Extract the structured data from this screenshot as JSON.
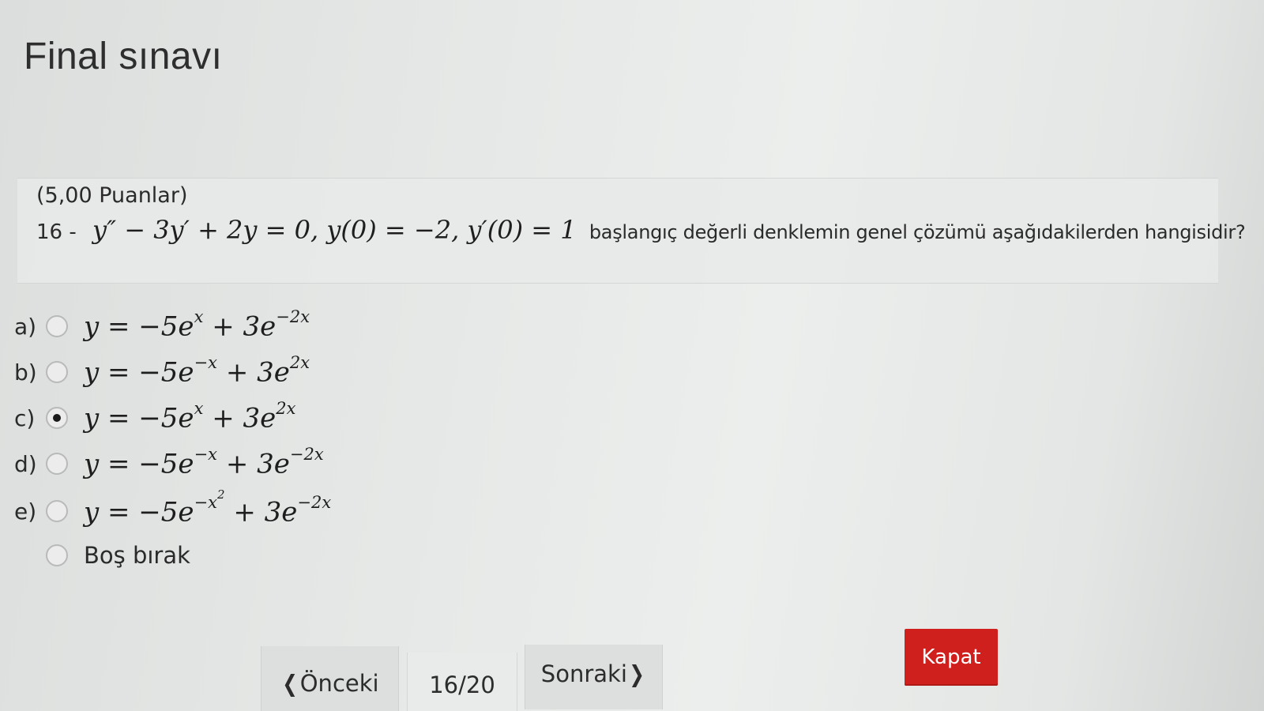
{
  "page": {
    "title": "Final sınavı"
  },
  "question": {
    "points": "(5,00 Puanlar)",
    "number": "16 -",
    "equation": "y″ − 3y′ + 2y = 0,  y(0) = −2,  y′(0) = 1",
    "text": "başlangıç değerli denklemin genel çözümü aşağıdakilerden hangisidir?"
  },
  "options": [
    {
      "letter": "a)",
      "selected": false
    },
    {
      "letter": "b)",
      "selected": false
    },
    {
      "letter": "c)",
      "selected": true
    },
    {
      "letter": "d)",
      "selected": false
    },
    {
      "letter": "e)",
      "selected": false
    },
    {
      "letter": "",
      "label": "Boş bırak",
      "selected": false
    }
  ],
  "navigation": {
    "prev_label": "Önceki",
    "page": "16/20",
    "next_label": "Sonraki",
    "close_label": "Kapat"
  },
  "colors": {
    "close_button": "#d0201d",
    "background": "#e6e8e7"
  },
  "icons": {
    "prev": "chevron-left-icon",
    "next": "chevron-right-icon"
  }
}
